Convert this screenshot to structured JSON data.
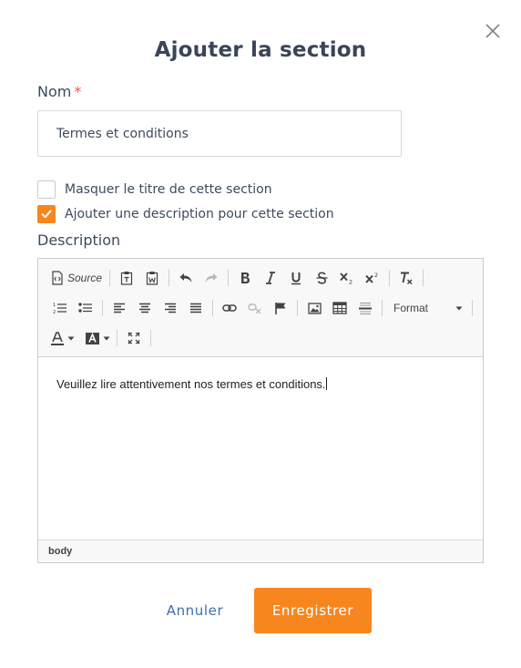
{
  "dialog": {
    "title": "Ajouter la section",
    "close_icon": "close-icon"
  },
  "name_field": {
    "label": "Nom",
    "required_mark": "*",
    "value": "Termes et conditions"
  },
  "options": [
    {
      "label": "Masquer le titre de cette section",
      "checked": false
    },
    {
      "label": "Ajouter une description pour cette section",
      "checked": true
    }
  ],
  "description": {
    "label": "Description",
    "toolbar": {
      "source_label": "Source",
      "format_label": "Format",
      "icons_row1": [
        "source-icon",
        "paste-text-icon",
        "paste-word-icon",
        "undo-icon",
        "redo-icon",
        "bold-icon",
        "italic-icon",
        "underline-icon",
        "strikethrough-icon",
        "subscript-icon",
        "superscript-icon",
        "remove-format-icon"
      ],
      "icons_row2": [
        "numbered-list-icon",
        "bulleted-list-icon",
        "align-left-icon",
        "align-center-icon",
        "align-right-icon",
        "justify-icon",
        "link-icon",
        "unlink-icon",
        "anchor-icon",
        "image-icon",
        "table-icon",
        "horizontal-line-icon",
        "format-dropdown"
      ],
      "icons_row3": [
        "text-color-icon",
        "background-color-icon",
        "maximize-icon"
      ]
    },
    "content": "Veuillez lire attentivement nos termes et conditions.",
    "status_path": "body"
  },
  "actions": {
    "cancel_label": "Annuler",
    "save_label": "Enregistrer"
  },
  "colors": {
    "accent": "#f7861f",
    "link": "#3b6fb0",
    "required": "#f05a4a"
  }
}
